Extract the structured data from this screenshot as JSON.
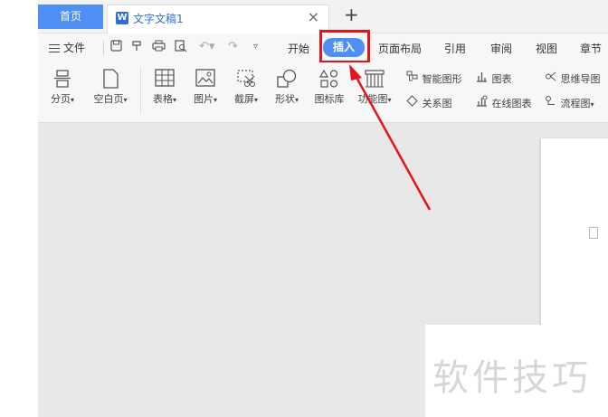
{
  "tabs": {
    "home": "首页",
    "document": "文字文稿1",
    "doc_icon_letter": "W",
    "close_glyph": "×",
    "new_glyph": "+"
  },
  "menu": {
    "file": "文件",
    "items": [
      "开始",
      "插入",
      "页面布局",
      "引用",
      "审阅",
      "视图",
      "章节"
    ],
    "active": "插入"
  },
  "ribbon": {
    "big_buttons": [
      {
        "label": "分页",
        "icon": "page-break-icon"
      },
      {
        "label": "空白页",
        "icon": "blank-page-icon"
      },
      {
        "label": "表格",
        "icon": "table-icon"
      },
      {
        "label": "图片",
        "icon": "picture-icon"
      },
      {
        "label": "截屏",
        "icon": "screenshot-icon"
      },
      {
        "label": "形状",
        "icon": "shapes-icon"
      },
      {
        "label": "图标库",
        "icon": "icon-library-icon"
      },
      {
        "label": "功能图",
        "icon": "function-chart-icon"
      }
    ],
    "small_buttons": [
      {
        "label": "智能图形",
        "icon": "smart-graphic-icon"
      },
      {
        "label": "关系图",
        "icon": "relation-chart-icon"
      },
      {
        "label": "图表",
        "icon": "chart-icon"
      },
      {
        "label": "在线图表",
        "icon": "online-chart-icon"
      },
      {
        "label": "思维导图",
        "icon": "mindmap-icon"
      },
      {
        "label": "流程图",
        "icon": "flowchart-icon"
      }
    ],
    "dropdown_glyph": "▾"
  },
  "watermark": "软件技巧",
  "colors": {
    "accent": "#4f8ff3",
    "highlight": "#e6141a",
    "arrow": "#e6141a"
  }
}
